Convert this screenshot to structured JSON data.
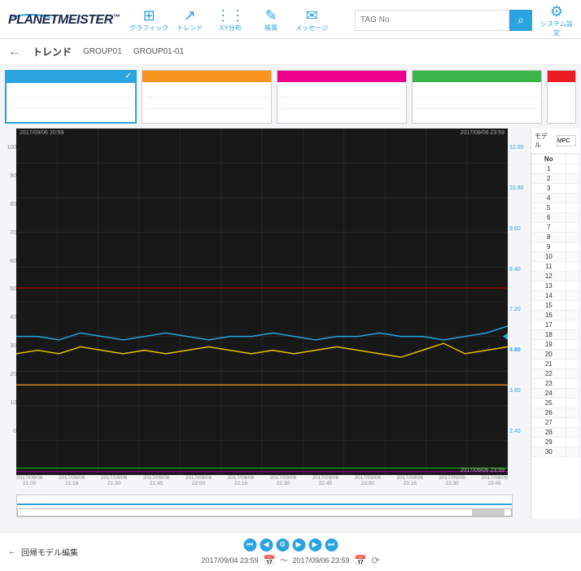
{
  "header": {
    "logo_text": "PLANETMEISTER",
    "logo_tm": "™",
    "nav": [
      {
        "icon": "⊞",
        "label": "グラフィック"
      },
      {
        "icon": "↗",
        "label": "トレンド"
      },
      {
        "icon": "⋮⋮",
        "label": "XY分布"
      },
      {
        "icon": "✎",
        "label": "帳票"
      },
      {
        "icon": "✉",
        "label": "メッセージ"
      }
    ],
    "search_placeholder": "TAG No",
    "search_icon": "⌕",
    "settings_label": "システム設定",
    "settings_icon": "⚙"
  },
  "breadcrumb": {
    "back": "←",
    "title": "トレンド",
    "group": "GROUP01",
    "subgroup": "GROUP01-01"
  },
  "thumbnails": {
    "selected_check": "✓",
    "colors": [
      "#2aa3e0",
      "#f7941d",
      "#ec008c",
      "#39b54a",
      "#ed1c24"
    ]
  },
  "chart_data": {
    "type": "line",
    "title": "",
    "x_label_format": "YYYY/MM/DD HH:mm",
    "corner_labels": {
      "top_left": "2017/09/06 20:59",
      "top_right": "2017/09/06 23:59",
      "bottom_right": "2017/09/06 23:59"
    },
    "y_left": {
      "min": 0,
      "max": 100,
      "ticks": [
        0,
        10,
        20,
        30,
        40,
        50,
        60,
        70,
        80,
        90,
        100
      ]
    },
    "y_right": {
      "ticks": [
        "2.40",
        "3.60",
        "4.80",
        "7.20",
        "8.40",
        "9.60",
        "10.80",
        "12.00"
      ],
      "highlight": "4.80"
    },
    "x_ticks": [
      "2017/09/06 21:00",
      "2017/09/06 21:16",
      "2017/09/06 21:30",
      "2017/09/06 21:45",
      "2017/09/06 22:00",
      "2017/09/06 22:16",
      "2017/09/06 22:30",
      "2017/09/06 22:45",
      "2017/09/06 23:00",
      "2017/09/06 23:16",
      "2017/09/06 23:30",
      "2017/09/06 23:45"
    ],
    "series": [
      {
        "name": "red-hi",
        "color": "#a00",
        "flat": 54
      },
      {
        "name": "orange",
        "color": "#f7941d",
        "flat": 26
      },
      {
        "name": "green-lo",
        "color": "#0a0",
        "flat": 2
      },
      {
        "name": "purple-lo",
        "color": "#909",
        "flat": 1
      },
      {
        "name": "blue",
        "color": "#2aa3e0",
        "values": [
          40,
          40,
          39,
          41,
          40,
          39,
          40,
          41,
          40,
          39,
          40,
          40,
          41,
          40,
          39,
          40,
          40,
          41,
          40,
          40,
          39,
          40,
          41,
          43
        ]
      },
      {
        "name": "yellow",
        "color": "#e5c100",
        "values": [
          35,
          36,
          35,
          37,
          36,
          35,
          36,
          35,
          36,
          37,
          36,
          35,
          36,
          35,
          36,
          37,
          36,
          35,
          34,
          36,
          38,
          35,
          36,
          37
        ]
      }
    ]
  },
  "side_panel": {
    "model_label": "モデル",
    "model_value": "MPC",
    "col_header": "No",
    "rows": [
      1,
      2,
      3,
      4,
      5,
      6,
      7,
      8,
      9,
      10,
      11,
      12,
      13,
      14,
      15,
      16,
      17,
      18,
      19,
      20,
      21,
      22,
      23,
      24,
      25,
      26,
      27,
      28,
      29,
      30
    ]
  },
  "footer": {
    "back_label": "回帰モデル編集",
    "back_arrow": "←",
    "playback": {
      "first": "⏮",
      "prev": "◀",
      "settings": "⚙",
      "play": "▶",
      "next": "▶",
      "last": "⏭"
    },
    "date_from": "2017/09/04 23:59",
    "date_to": "2017/09/06 23:59",
    "separator": "〜",
    "cal_icon": "📅",
    "refresh_icon": "⟳"
  }
}
